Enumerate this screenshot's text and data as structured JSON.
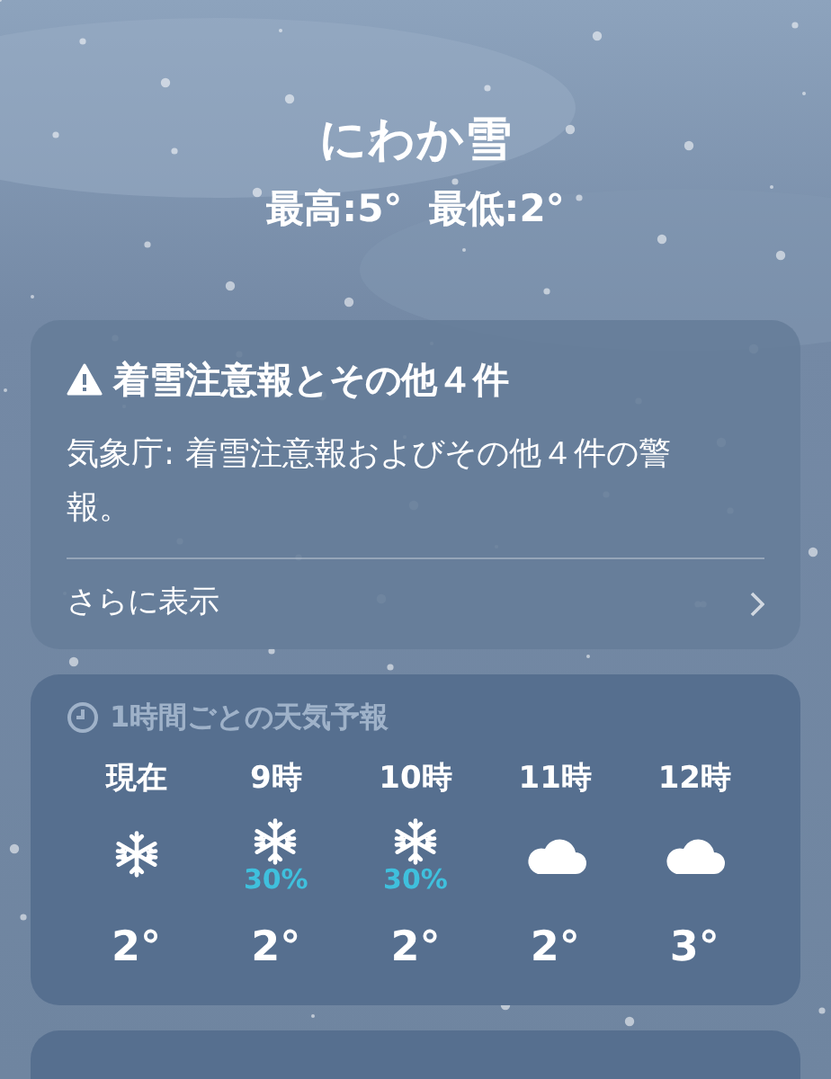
{
  "current": {
    "condition": "にわか雪",
    "high_low": "最高:5°  最低:2°"
  },
  "alert": {
    "title": "着雪注意報とその他４件",
    "body": "気象庁: 着雪注意報およびその他４件の警報。",
    "more": "さらに表示"
  },
  "hourly": {
    "title": "1時間ごとの天気予報",
    "hours": [
      {
        "time": "現在",
        "kind": "snow",
        "temp": "2°"
      },
      {
        "time": "9時",
        "kind": "snow",
        "precip": "30%",
        "temp": "2°"
      },
      {
        "time": "10時",
        "kind": "snow",
        "precip": "30%",
        "temp": "2°"
      },
      {
        "time": "11時",
        "kind": "cloud",
        "temp": "2°"
      },
      {
        "time": "12時",
        "kind": "cloud",
        "temp": "3°"
      }
    ]
  }
}
